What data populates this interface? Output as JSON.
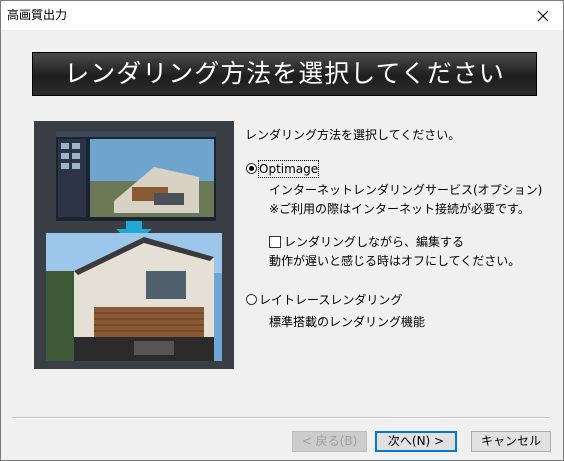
{
  "window": {
    "title": "高画質出力"
  },
  "banner": {
    "text": "レンダリング方法を選択してください"
  },
  "content": {
    "prompt": "レンダリング方法を選択してください。",
    "options": [
      {
        "label": "Optimage",
        "checked": true,
        "description": [
          "インターネットレンダリングサービス(オプション)",
          "※ご利用の際はインターネット接続が必要です。"
        ],
        "sub_checkbox": {
          "label": "レンダリングしながら、編集する",
          "checked": false,
          "note": "動作が遅いと感じる時はオフにしてください。"
        }
      },
      {
        "label": "レイトレースレンダリング",
        "checked": false,
        "description": [
          "標準搭載のレンダリング機能"
        ]
      }
    ]
  },
  "buttons": {
    "back": "< 戻る(B)",
    "next": "次へ(N) >",
    "cancel": "キャンセル"
  },
  "colors": {
    "banner_bg": "#1e1e1e",
    "arrow": "#1fa9d6",
    "default_button_border": "#0078d7"
  },
  "icons": {
    "close": "close-icon",
    "arrow": "down-arrow-icon"
  }
}
